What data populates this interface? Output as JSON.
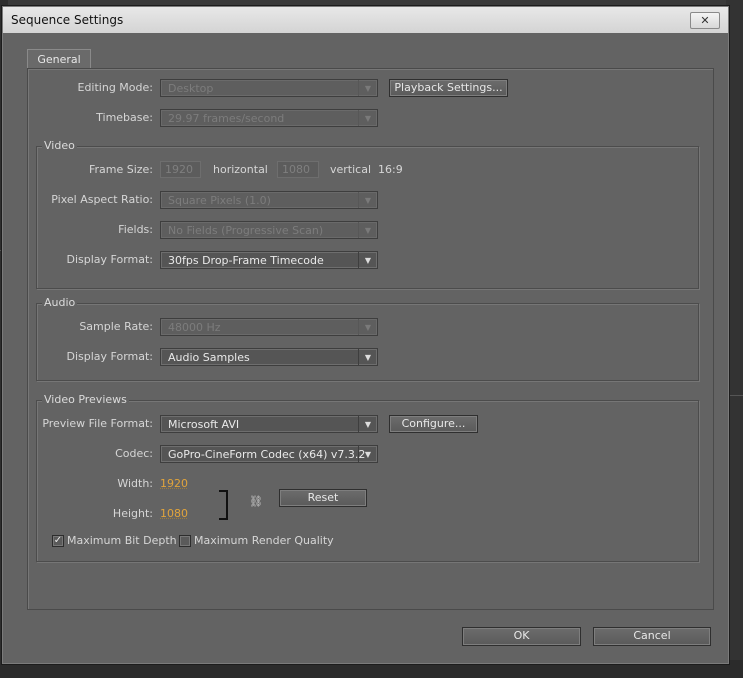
{
  "dialog": {
    "title": "Sequence Settings",
    "close_glyph": "✕",
    "tab_general": "General"
  },
  "editing": {
    "mode_label": "Editing Mode:",
    "mode_value": "Desktop",
    "playback_button": "Playback Settings...",
    "timebase_label": "Timebase:",
    "timebase_value": "29.97 frames/second"
  },
  "video": {
    "group_title": "Video",
    "frame_size_label": "Frame Size:",
    "frame_width": "1920",
    "horizontal_label": "horizontal",
    "frame_height": "1080",
    "vertical_label": "vertical",
    "aspect_ratio": "16:9",
    "pixel_aspect_label": "Pixel Aspect Ratio:",
    "pixel_aspect_value": "Square Pixels (1.0)",
    "fields_label": "Fields:",
    "fields_value": "No Fields (Progressive Scan)",
    "display_format_label": "Display Format:",
    "display_format_value": "30fps Drop-Frame Timecode"
  },
  "audio": {
    "group_title": "Audio",
    "sample_rate_label": "Sample Rate:",
    "sample_rate_value": "48000 Hz",
    "display_format_label": "Display Format:",
    "display_format_value": "Audio Samples"
  },
  "previews": {
    "group_title": "Video Previews",
    "file_format_label": "Preview File Format:",
    "file_format_value": "Microsoft AVI",
    "configure_button": "Configure...",
    "codec_label": "Codec:",
    "codec_value": "GoPro-CineForm Codec (x64) v7.3.2",
    "width_label": "Width:",
    "width_value": "1920",
    "height_label": "Height:",
    "height_value": "1080",
    "reset_button": "Reset",
    "max_bit_depth_label": "Maximum Bit Depth",
    "max_bit_depth_checked": true,
    "max_render_quality_label": "Maximum Render Quality",
    "max_render_quality_checked": false
  },
  "footer": {
    "ok_button": "OK",
    "cancel_button": "Cancel"
  }
}
